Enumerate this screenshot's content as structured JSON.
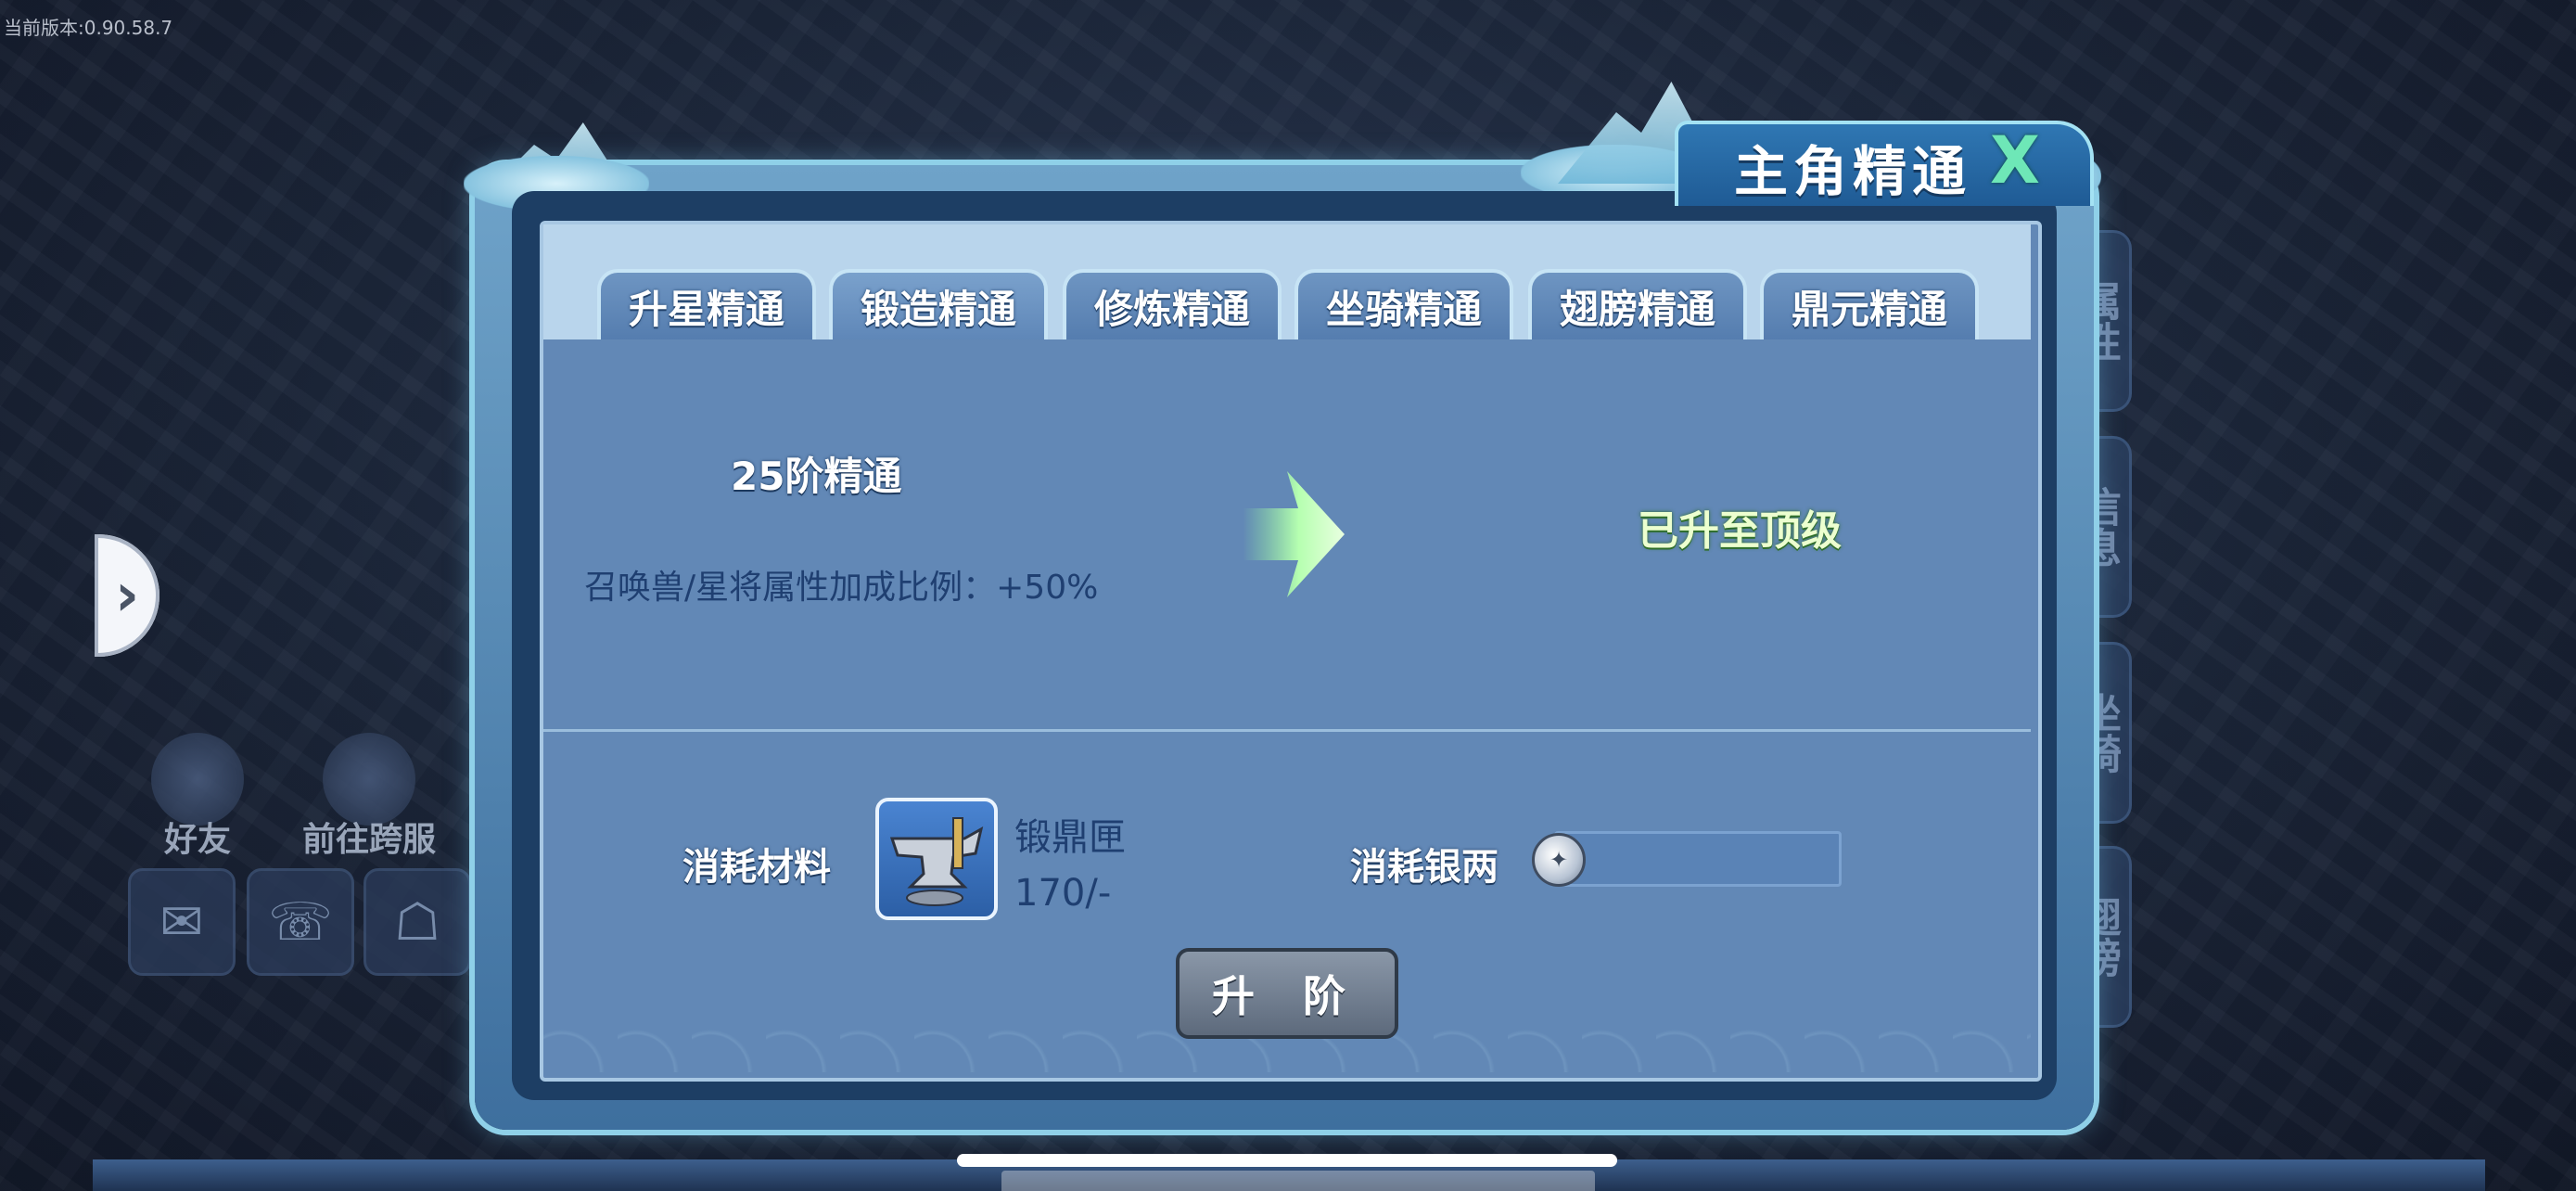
{
  "version_text": "当前版本:0.90.58.7",
  "modal": {
    "title": "主角精通",
    "close_label": "X",
    "tabs": [
      {
        "label": "升星精通"
      },
      {
        "label": "锻造精通"
      },
      {
        "label": "修炼精通"
      },
      {
        "label": "坐骑精通"
      },
      {
        "label": "翅膀精通"
      },
      {
        "label": "鼎元精通"
      }
    ],
    "current_level": "25阶精通",
    "bonus_text": "召唤兽/星将属性加成比例：+50%",
    "status_text": "已升至顶级",
    "materials_label": "消耗材料",
    "item_name": "锻鼎匣",
    "item_count": "170/-",
    "silver_label": "消耗银两",
    "upgrade_button": "升 阶"
  },
  "shortcuts": [
    {
      "label": "好友"
    },
    {
      "label": "前往跨服"
    }
  ],
  "side_tabs": [
    {
      "label": "属性"
    },
    {
      "label": "信息"
    },
    {
      "label": "坐骑"
    },
    {
      "label": "翅膀"
    }
  ],
  "icons": {
    "expand": "chevron-right-icon",
    "close": "close-icon",
    "arrow": "arrow-right-icon",
    "item": "anvil-icon",
    "coin": "silver-coin-icon"
  },
  "colors": {
    "panel": "#6288b6",
    "tabbar": "#b9d5ec",
    "status_green": "#ecffcf",
    "close_green": "#6ee7b7",
    "frame": "#8fd0e8"
  }
}
